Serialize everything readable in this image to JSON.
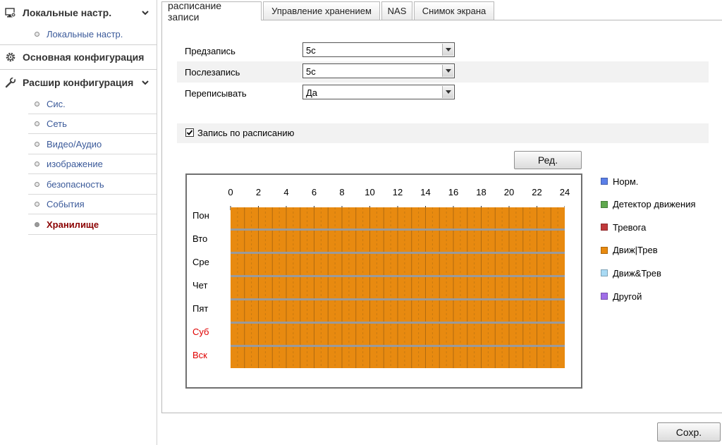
{
  "sidebar": {
    "sections": [
      {
        "title": "Локальные настр.",
        "icon": "monitor-settings-icon"
      },
      {
        "title": "Основная конфигурация",
        "icon": "gear-icon"
      },
      {
        "title": "Расшир конфигурация",
        "icon": "wrench-icon"
      }
    ],
    "local_items": [
      "Локальные настр."
    ],
    "advanced_items": [
      "Сис.",
      "Сеть",
      "Видео/Аудио",
      "изображение",
      "безопасность",
      "События",
      "Хранилище"
    ],
    "active_item": "Хранилище"
  },
  "tabs": [
    "расписание записи",
    "Управление хранением",
    "NAS",
    "Снимок экрана"
  ],
  "active_tab": "расписание записи",
  "form": {
    "pre_record": {
      "label": "Предзапись",
      "value": "5с"
    },
    "post_record": {
      "label": "Послезапись",
      "value": "5с"
    },
    "overwrite": {
      "label": "Переписывать",
      "value": "Да"
    }
  },
  "schedule": {
    "enable_label": "Запись по расписанию",
    "enabled": true,
    "edit_button": "Ред.",
    "hour_labels": [
      "0",
      "2",
      "4",
      "6",
      "8",
      "10",
      "12",
      "14",
      "16",
      "18",
      "20",
      "22",
      "24"
    ],
    "days": [
      {
        "label": "Пон",
        "weekend": false,
        "type": "Движ|Трев"
      },
      {
        "label": "Вто",
        "weekend": false,
        "type": "Движ|Трев"
      },
      {
        "label": "Сре",
        "weekend": false,
        "type": "Движ|Трев"
      },
      {
        "label": "Чет",
        "weekend": false,
        "type": "Движ|Трев"
      },
      {
        "label": "Пят",
        "weekend": false,
        "type": "Движ|Трев"
      },
      {
        "label": "Суб",
        "weekend": true,
        "type": "Движ|Трев"
      },
      {
        "label": "Вск",
        "weekend": true,
        "type": "Движ|Трев"
      }
    ],
    "fill_color": "#e88a10",
    "weekend_label_color": "#e00000"
  },
  "legend": [
    {
      "label": "Норм.",
      "color": "#5b7fe8"
    },
    {
      "label": "Детектор движения",
      "color": "#5fa84e"
    },
    {
      "label": "Тревога",
      "color": "#c0393b"
    },
    {
      "label": "Движ|Трев",
      "color": "#e88a10"
    },
    {
      "label": "Движ&Трев",
      "color": "#a9daf4"
    },
    {
      "label": "Другой",
      "color": "#a06ee8"
    }
  ],
  "save_button": "Сохр."
}
